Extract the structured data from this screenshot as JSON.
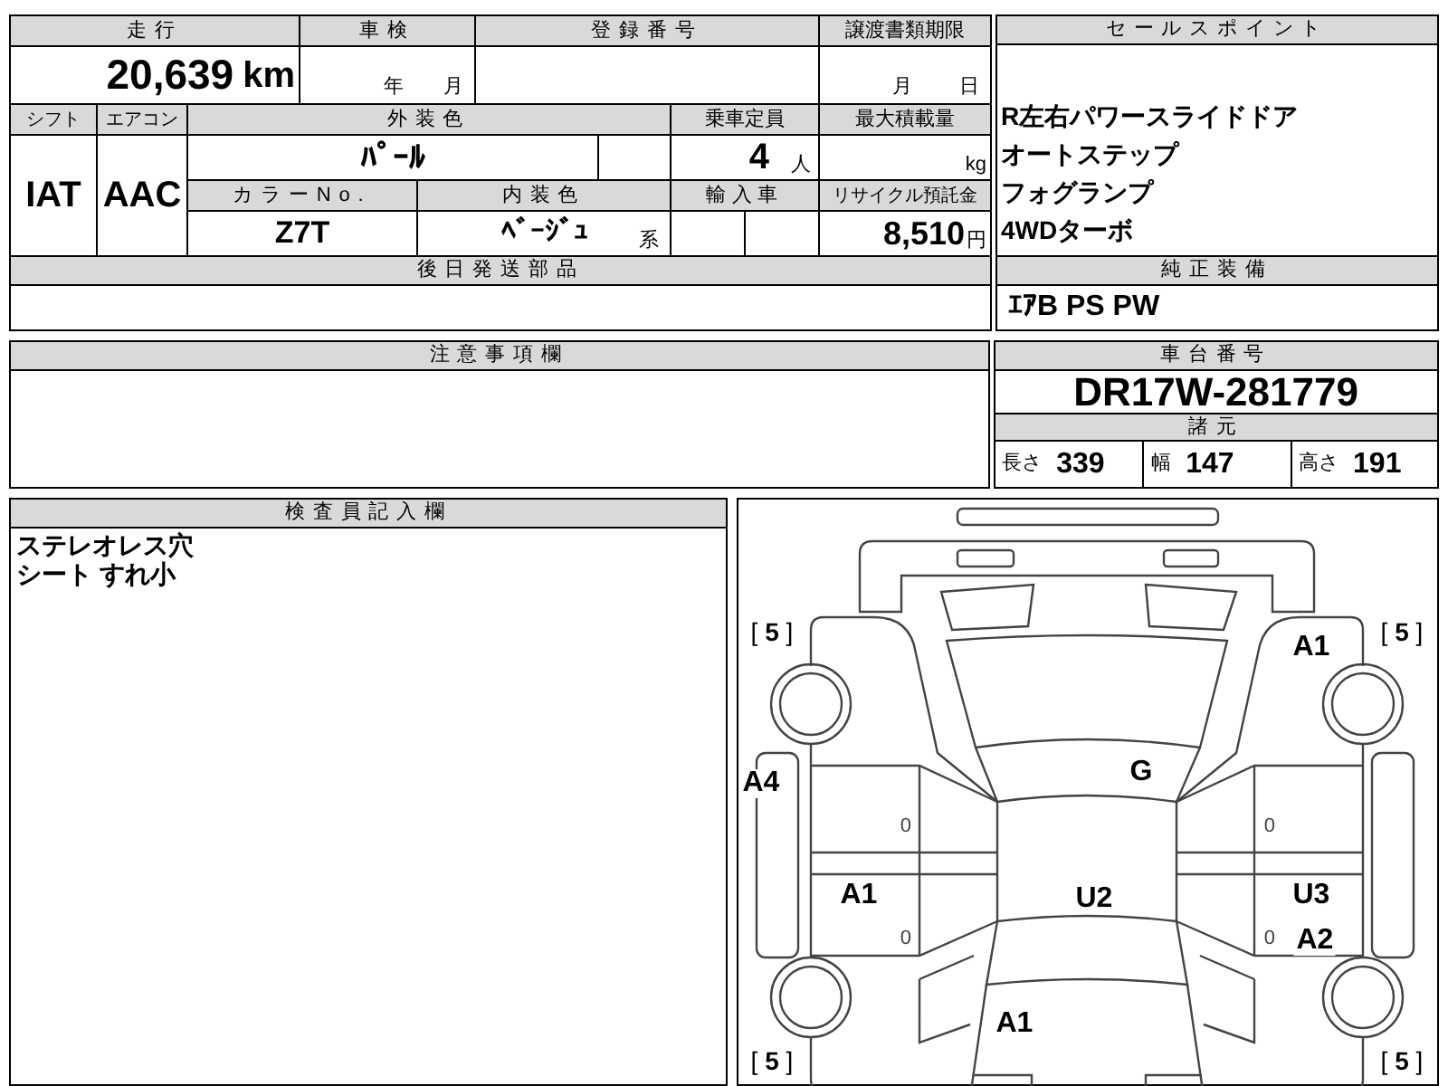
{
  "vehicle_info": {
    "mileage": {
      "label": "走行",
      "value": "20,639",
      "unit": "km"
    },
    "inspection": {
      "label": "車検",
      "year_unit": "年",
      "month_unit": "月"
    },
    "registration_number": {
      "label": "登録番号"
    },
    "transfer_deadline": {
      "label": "譲渡書類期限",
      "month_unit": "月",
      "day_unit": "日"
    },
    "shift": {
      "label": "シフト",
      "value": "IAT"
    },
    "air_conditioner": {
      "label": "エアコン",
      "value": "AAC"
    },
    "exterior_color": {
      "label": "外装色",
      "value": "ﾊﾟｰﾙ"
    },
    "capacity": {
      "label": "乗車定員",
      "value": "4",
      "unit": "人"
    },
    "max_load": {
      "label": "最大積載量",
      "unit": "kg"
    },
    "color_number": {
      "label": "カラーNo.",
      "value": "Z7T"
    },
    "interior_color": {
      "label": "内装色",
      "value": "ﾍﾞｰｼﾞｭ",
      "suffix": "系"
    },
    "imported": {
      "label": "輸入車"
    },
    "recycling_fee": {
      "label": "リサイクル預託金",
      "value": "8,510",
      "unit": "円"
    },
    "parts_to_ship": {
      "label": "後日発送部品"
    }
  },
  "sale_points": {
    "label": "セールスポイント",
    "lines": [
      "R左右パワースライドドア",
      "オートステップ",
      "フォグランプ",
      "4WDターボ"
    ]
  },
  "genuine_equipment": {
    "label": "純正装備",
    "value": "ｴｱB PS PW"
  },
  "notes": {
    "label": "注意事項欄"
  },
  "chassis": {
    "label": "車台番号",
    "value": "DR17W-281779",
    "specs_label": "諸元",
    "specs": [
      {
        "label": "長さ",
        "value": "339"
      },
      {
        "label": "幅",
        "value": "147"
      },
      {
        "label": "高さ",
        "value": "191"
      }
    ]
  },
  "inspector_notes": {
    "label": "検査員記入欄",
    "lines": [
      "ステレオレス穴",
      "シート すれ小"
    ]
  },
  "damage_map": {
    "marks": [
      {
        "kind": "tire",
        "text": "[ **5** ]"
      },
      {
        "kind": "tire",
        "text": "[ **5** ]"
      },
      {
        "kind": "damage",
        "text": "A1"
      },
      {
        "kind": "damage",
        "text": "A4"
      },
      {
        "kind": "damage",
        "text": "G"
      },
      {
        "kind": "count",
        "text": "0"
      },
      {
        "kind": "count",
        "text": "0"
      },
      {
        "kind": "damage",
        "text": "A1"
      },
      {
        "kind": "damage",
        "text": "U2"
      },
      {
        "kind": "damage",
        "text": "U3"
      },
      {
        "kind": "count",
        "text": "0"
      },
      {
        "kind": "count",
        "text": "0"
      },
      {
        "kind": "damage",
        "text": "A2"
      },
      {
        "kind": "damage",
        "text": "A1"
      },
      {
        "kind": "tire",
        "text": "[ **5** ]"
      },
      {
        "kind": "tire",
        "text": "[ **5** ]"
      }
    ]
  }
}
